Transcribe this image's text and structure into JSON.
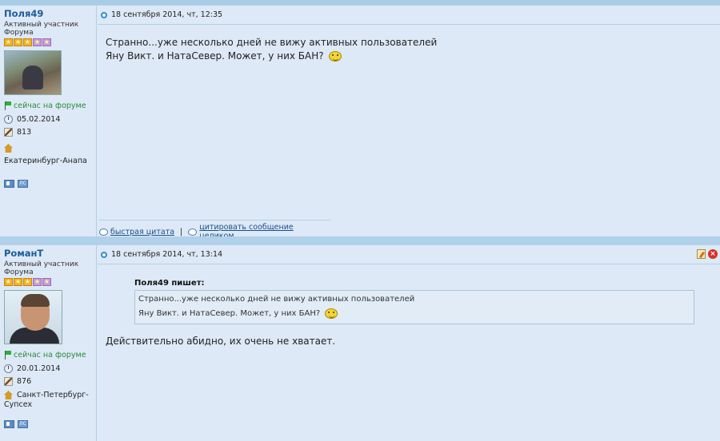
{
  "posts": [
    {
      "author": "Поля49",
      "rank": "Активный участник Форума",
      "online": "сейчас на форуме",
      "reg_date": "05.02.2014",
      "post_count": "813",
      "location": "Екатеринбург-Анапа",
      "timestamp": "18 сентября 2014, чт, 12:35",
      "message_lines": [
        "Странно...уже несколько дней не вижу активных пользователей",
        "Яну Викт. и НатаСевер. Может, у них БАН?"
      ],
      "quick_quote": "быстрая цитата",
      "full_quote": "цитировать сообщение целиком"
    },
    {
      "author": "РоманТ",
      "rank": "Активный участник Форума",
      "online": "сейчас на форуме",
      "reg_date": "20.01.2014",
      "post_count": "876",
      "location_line1": "Санкт-Петербург-",
      "location_line2": "Супсех",
      "timestamp": "18 сентября 2014, чт, 13:14",
      "quote_author": "Поля49 пишет:",
      "quote_lines": [
        "Странно...уже несколько дней не вижу активных пользователей",
        "Яну Викт. и НатаСевер. Может, у них БАН?"
      ],
      "message": "Действительно абидно, их очень не хватает."
    }
  ],
  "icons": {
    "star": "star-icon",
    "online": "flag-icon",
    "clock": "clock-icon",
    "posts": "pencil-icon",
    "location": "home-icon",
    "profile": "profile-icon",
    "pm": "pm-icon",
    "smiley": "smiley-icon",
    "edit": "edit-icon",
    "delete": "delete-icon"
  },
  "small_buttons": {
    "pm_label": "ЛС"
  },
  "colors": {
    "username": "#1b5c9a",
    "online": "#2c8a3a",
    "star_gold": "#f0b32a",
    "star_purple": "#c89ad8",
    "link": "#1a4f8a"
  }
}
